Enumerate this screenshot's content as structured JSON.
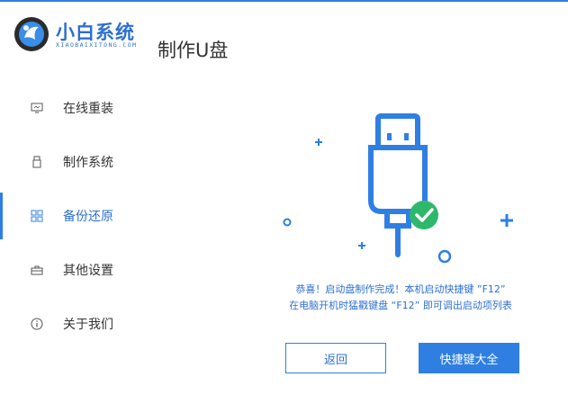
{
  "app": {
    "brand_name": "小白系统",
    "brand_subtitle": "XIAOBAIXITONG.COM",
    "page_title": "制作U盘",
    "accent_color": "#2f7fe3"
  },
  "sidebar": {
    "items": [
      {
        "label": "在线重装",
        "icon": "monitor-icon",
        "active": false
      },
      {
        "label": "制作系统",
        "icon": "usb-icon",
        "active": false
      },
      {
        "label": "备份还原",
        "icon": "grid-icon",
        "active": true
      },
      {
        "label": "其他设置",
        "icon": "toolbox-icon",
        "active": false
      },
      {
        "label": "关于我们",
        "icon": "info-icon",
        "active": false
      }
    ]
  },
  "main": {
    "message_line1": "恭喜！启动盘制作完成！本机启动快捷键 ”F12”",
    "message_line2": "在电脑开机时猛戳键盘 “F12” 即可调出启动项列表",
    "back_button": "返回",
    "shortcut_button": "快捷键大全"
  }
}
